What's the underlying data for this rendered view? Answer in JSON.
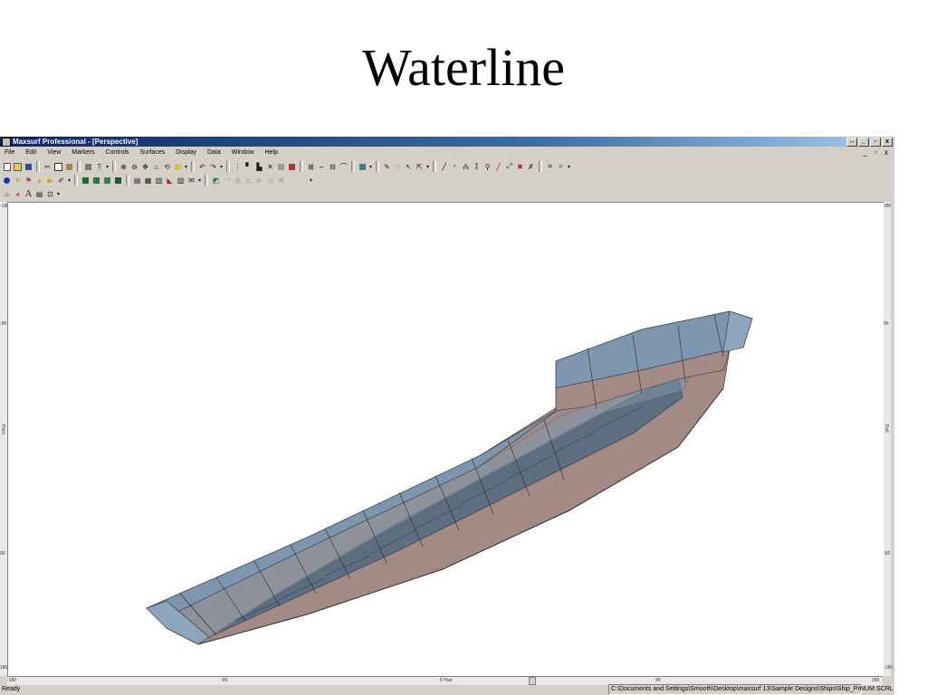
{
  "slide": {
    "title": "Waterline"
  },
  "window": {
    "title": "Maxsurf Professional - [Perspective]",
    "controls": [
      "↔",
      "_",
      "▫",
      "x"
    ]
  },
  "menu": [
    "File",
    "Edit",
    "View",
    "Markers",
    "Controls",
    "Surfaces",
    "Display",
    "Data",
    "Window",
    "Help"
  ],
  "mdi_controls": "_ ▫ x",
  "rulers": {
    "left_label": "Pitch",
    "right_label": "Roll",
    "bottom_label": "0 Yaw",
    "left_ticks": [
      "-180",
      "-90",
      "90",
      "180"
    ],
    "right_ticks": [
      "180",
      "90",
      "-90",
      "-180"
    ],
    "bottom_ticks": [
      "-180",
      "-90",
      "90",
      "180"
    ]
  },
  "status": {
    "ready": "Ready",
    "path": "C:\\Documents and Settings\\Smooth\\Desktop\\maxsurf 13\\Sample Designs\\Ships\\Ship_Pro.msd*",
    "num": "NUM",
    "scrl": "SCRL"
  },
  "colors": {
    "hull_top": "#7d95ad",
    "hull_side": "#a38a84",
    "deck": "#5c6f80",
    "toolbar_bg": "#d4d0c8",
    "titlebar": "#0a246a"
  }
}
